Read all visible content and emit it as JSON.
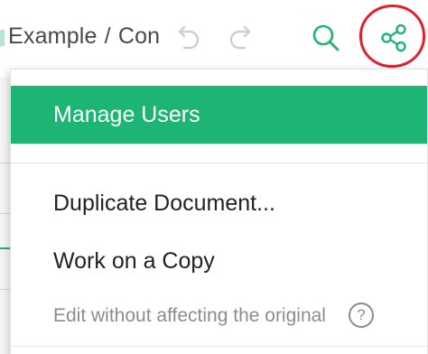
{
  "toolbar": {
    "breadcrumb": {
      "doc_name": "Example",
      "separator": "/",
      "page_name": "Con"
    },
    "undo_icon": "undo-icon",
    "redo_icon": "redo-icon",
    "search_icon": "search-icon",
    "share_icon": "share-icon"
  },
  "share_menu": {
    "items": [
      {
        "label": "Manage Users",
        "active": true
      },
      {
        "label": "Duplicate Document..."
      },
      {
        "label": "Work on a Copy"
      }
    ],
    "hint": "Edit without affecting the original",
    "help_label": "?"
  },
  "colors": {
    "accent": "#1cb574",
    "highlight_ring": "#e0202f",
    "hint_text": "#8c8c8c"
  }
}
